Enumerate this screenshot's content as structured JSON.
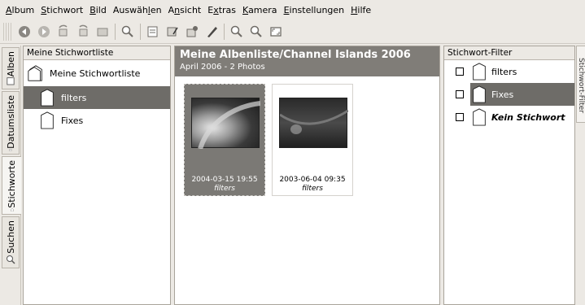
{
  "menu": {
    "items": [
      {
        "pre": "",
        "u": "A",
        "post": "lbum"
      },
      {
        "pre": "",
        "u": "S",
        "post": "tichwort"
      },
      {
        "pre": "",
        "u": "B",
        "post": "ild"
      },
      {
        "pre": "Auswäh",
        "u": "l",
        "post": "en"
      },
      {
        "pre": "A",
        "u": "n",
        "post": "sicht"
      },
      {
        "pre": "E",
        "u": "x",
        "post": "tras"
      },
      {
        "pre": "",
        "u": "K",
        "post": "amera"
      },
      {
        "pre": "",
        "u": "E",
        "post": "instellungen"
      },
      {
        "pre": "",
        "u": "H",
        "post": "ilfe"
      }
    ]
  },
  "sidetabs": {
    "alben": "Alben",
    "datumsliste": "Datumsliste",
    "stichworte": "Stichworte",
    "suchen": "Suchen"
  },
  "left_panel": {
    "header": "Meine Stichwortliste",
    "root": "Meine Stichwortliste",
    "items": [
      "filters",
      "Fixes"
    ],
    "selected_index": 0
  },
  "center_panel": {
    "title": "Meine Albenliste/Channel Islands 2006",
    "subtitle": "April 2006 - 2 Photos",
    "photos": [
      {
        "date": "2004-03-15 19:55",
        "keyword": "filters",
        "selected": true
      },
      {
        "date": "2003-06-04 09:35",
        "keyword": "filters",
        "selected": false
      }
    ]
  },
  "right_panel": {
    "header": "Stichwort-Filter",
    "items": [
      "filters",
      "Fixes",
      "Kein Stichwort"
    ],
    "selected_index": 1,
    "edge_tab": "Stichwort-Filter"
  },
  "colors": {
    "selection": "#6e6c68",
    "header_bg": "#807d78",
    "window_bg": "#ece9e4"
  }
}
